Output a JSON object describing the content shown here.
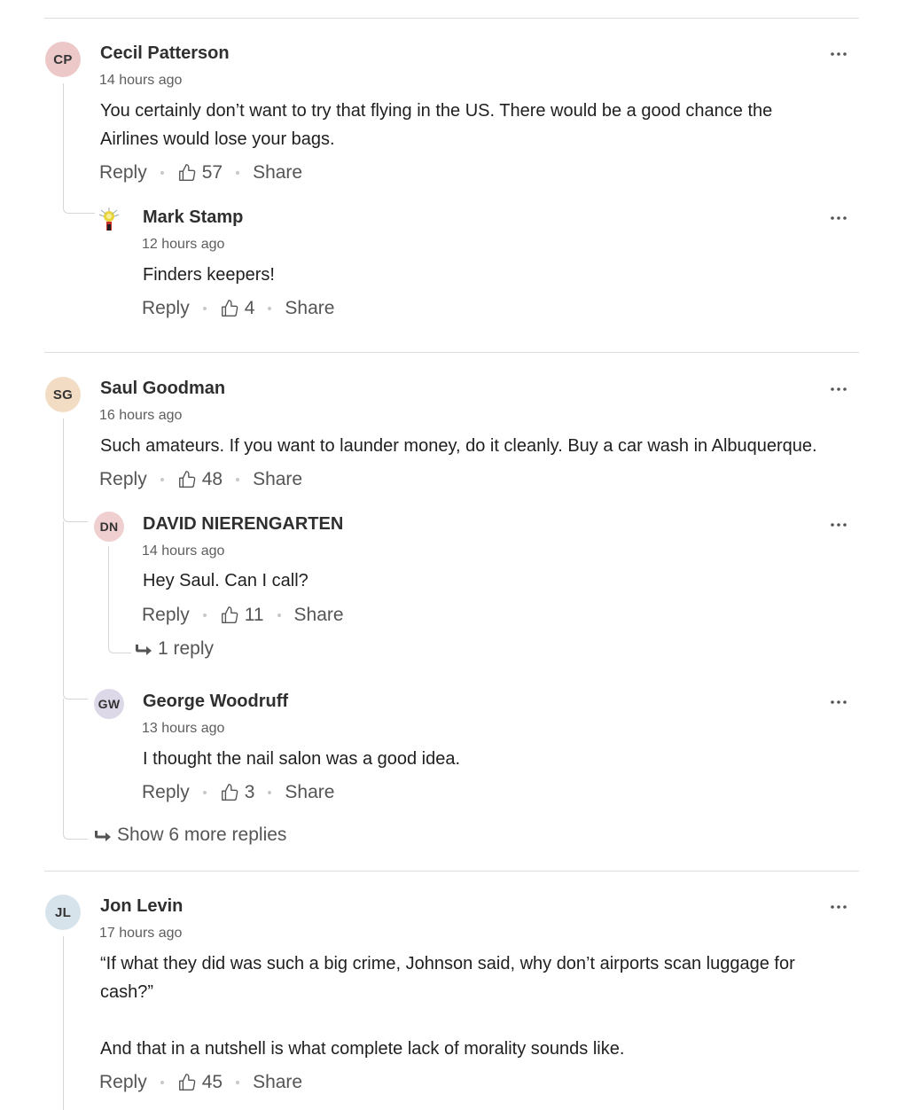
{
  "actions": {
    "reply": "Reply",
    "share": "Share"
  },
  "colors": {
    "cp": "#ecc8c8",
    "sg": "#f3dcc4",
    "dn": "#f0cfd0",
    "gw": "#ddd8e8",
    "jl": "#d6e3ea"
  },
  "comments": [
    {
      "initials": "CP",
      "name": "Cecil Patterson",
      "time": "14 hours ago",
      "text": [
        "You certainly don’t want to try that flying in the US.  There would be a good chance the",
        "Airlines would lose your bags."
      ],
      "likes": "57",
      "replies": [
        {
          "initials": "",
          "avatar": "photo-avatar",
          "name": "Mark Stamp",
          "time": "12 hours ago",
          "text": [
            "Finders keepers!"
          ],
          "likes": "4"
        }
      ]
    },
    {
      "initials": "SG",
      "name": "Saul Goodman",
      "time": "16 hours ago",
      "text": [
        "Such amateurs. If you want to launder money, do it cleanly. Buy a car wash in Albuquerque."
      ],
      "likes": "48",
      "replies": [
        {
          "initials": "DN",
          "name": "DAVID NIERENGARTEN",
          "time": "14 hours ago",
          "text": [
            "Hey Saul. Can I call?"
          ],
          "likes": "11",
          "reply_count": "1 reply"
        },
        {
          "initials": "GW",
          "name": "George Woodruff",
          "time": "13 hours ago",
          "text": [
            "I thought the nail salon was a good idea."
          ],
          "likes": "3"
        }
      ],
      "more_replies": "Show 6 more replies"
    },
    {
      "initials": "JL",
      "name": "Jon Levin",
      "time": "17 hours ago",
      "text": [
        "“If what they did was such a big crime, Johnson said, why don’t airports scan luggage for",
        "cash?”",
        "",
        "And that in a nutshell is what complete lack of morality sounds like."
      ],
      "likes": "45"
    }
  ]
}
